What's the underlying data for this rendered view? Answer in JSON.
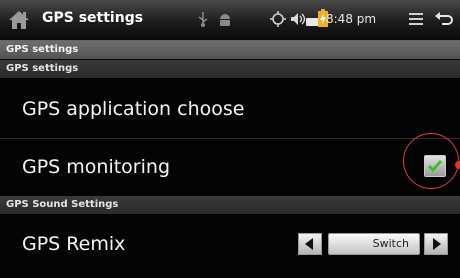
{
  "statusbar": {
    "title": "GPS settings",
    "time": "8:48 pm",
    "icons": [
      "home-icon",
      "usb-icon",
      "android-debug-icon",
      "gps-icon",
      "volume-icon",
      "battery-icon",
      "charging-icon",
      "menu-icon",
      "back-icon"
    ]
  },
  "header": {
    "section": "GPS settings"
  },
  "groups": {
    "gps_settings": "GPS settings",
    "sound_settings": "GPS Sound Settings"
  },
  "rows": {
    "app_choose": "GPS application choose",
    "monitoring": "GPS monitoring",
    "remix": "GPS Remix"
  },
  "monitoring": {
    "checked": true
  },
  "remix_control": {
    "switch_label": "Switch"
  },
  "colors": {
    "check": "#3cbf2a",
    "highlight": "#e0403a"
  }
}
